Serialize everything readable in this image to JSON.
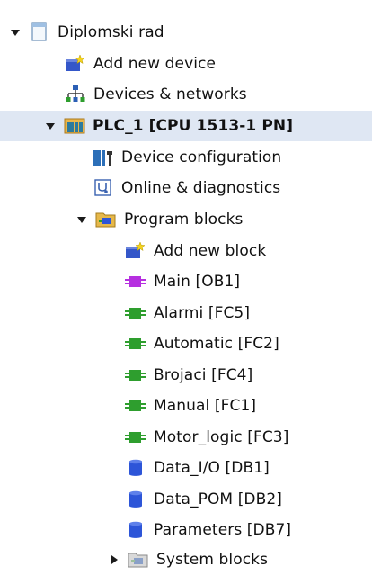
{
  "tree": {
    "root": {
      "label": "Diplomski rad",
      "expanded": true,
      "icon": "project-icon"
    },
    "add_device": {
      "label": "Add new device",
      "icon": "add-device-icon"
    },
    "devices_networks": {
      "label": "Devices & networks",
      "icon": "network-icon"
    },
    "plc": {
      "label": "PLC_1 [CPU 1513-1 PN]",
      "expanded": true,
      "icon": "plc-icon"
    },
    "device_config": {
      "label": "Device configuration",
      "icon": "device-config-icon"
    },
    "online_diag": {
      "label": "Online & diagnostics",
      "icon": "diagnostics-icon"
    },
    "program_blocks": {
      "label": "Program blocks",
      "expanded": true,
      "icon": "folder-icon"
    },
    "blocks": [
      {
        "label": "Add new block",
        "icon": "add-block-icon"
      },
      {
        "label": "Main [OB1]",
        "icon": "ob-block-icon"
      },
      {
        "label": "Alarmi [FC5]",
        "icon": "fc-block-icon"
      },
      {
        "label": "Automatic [FC2]",
        "icon": "fc-block-icon"
      },
      {
        "label": "Brojaci [FC4]",
        "icon": "fc-block-icon"
      },
      {
        "label": "Manual [FC1]",
        "icon": "fc-block-icon"
      },
      {
        "label": "Motor_logic [FC3]",
        "icon": "fc-block-icon"
      },
      {
        "label": "Data_I/O [DB1]",
        "icon": "db-block-icon"
      },
      {
        "label": "Data_POM [DB2]",
        "icon": "db-block-icon"
      },
      {
        "label": "Parameters [DB7]",
        "icon": "db-block-icon"
      }
    ],
    "system_blocks": {
      "label": "System blocks",
      "expanded": false,
      "icon": "folder-icon"
    }
  },
  "colors": {
    "ob_block": "#b62fe0",
    "fc_block": "#2e9e2e",
    "db_block": "#2d55d8",
    "folder": "#e6b84a",
    "selection": "#dfe7f3"
  }
}
